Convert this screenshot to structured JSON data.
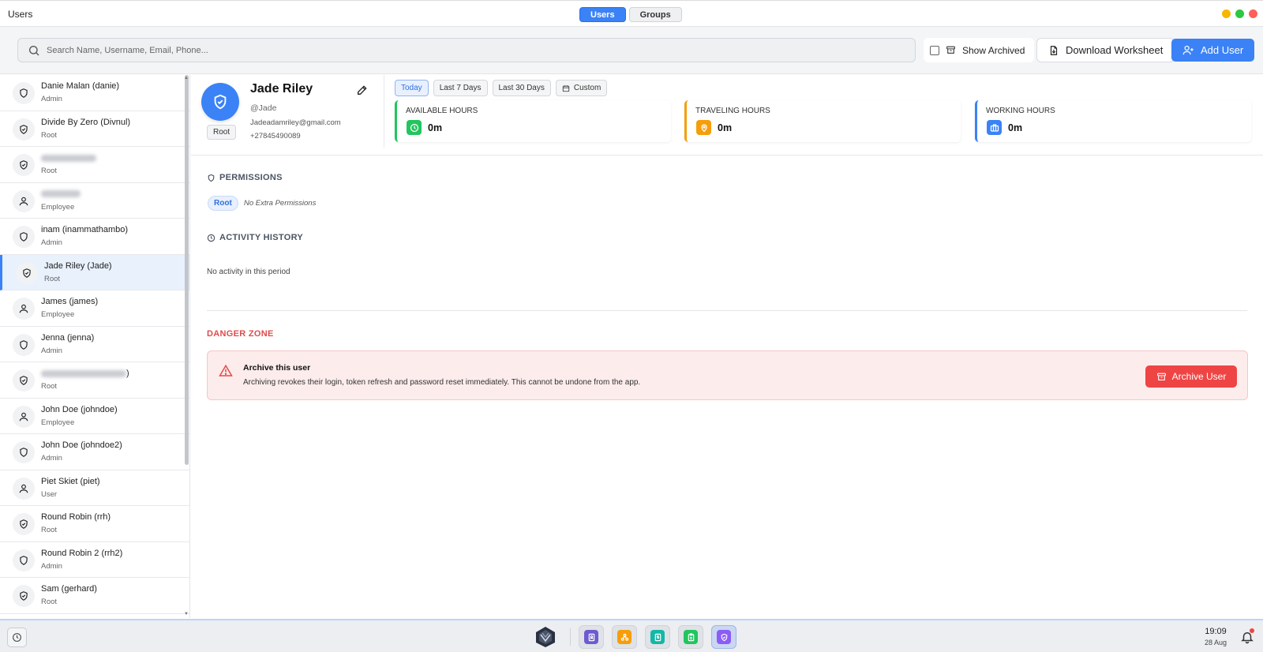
{
  "window": {
    "title": "Users"
  },
  "view_tabs": [
    {
      "label": "Users",
      "active": true
    },
    {
      "label": "Groups",
      "active": false
    }
  ],
  "window_controls": {
    "minimize_color": "#f5b700",
    "maximize_color": "#2bc840",
    "close_color": "#ff5f57"
  },
  "search": {
    "placeholder": "Search Name, Username, Email, Phone...",
    "value": ""
  },
  "toolbar": {
    "show_archived_label": "Show Archived",
    "show_archived_checked": false,
    "download_label": "Download Worksheet",
    "add_label": "Add User"
  },
  "users": [
    {
      "name": "Danie Malan (danie)",
      "role": "Admin",
      "icon": "shield-icon"
    },
    {
      "name": "Divide By Zero (Divnul)",
      "role": "Root",
      "icon": "shield-check-icon"
    },
    {
      "name": "",
      "role": "Root",
      "icon": "shield-check-icon",
      "redacted": true
    },
    {
      "name": "",
      "role": "Employee",
      "icon": "person-icon",
      "redacted": true
    },
    {
      "name": "inam (inammathambo)",
      "role": "Admin",
      "icon": "shield-icon"
    },
    {
      "name": "Jade Riley (Jade)",
      "role": "Root",
      "icon": "shield-check-icon",
      "selected": true
    },
    {
      "name": "James (james)",
      "role": "Employee",
      "icon": "person-icon"
    },
    {
      "name": "Jenna (jenna)",
      "role": "Admin",
      "icon": "shield-icon"
    },
    {
      "name": ")",
      "role": "Root",
      "icon": "shield-check-icon",
      "redacted": true
    },
    {
      "name": "John Doe (johndoe)",
      "role": "Employee",
      "icon": "person-icon"
    },
    {
      "name": "John Doe (johndoe2)",
      "role": "Admin",
      "icon": "shield-icon"
    },
    {
      "name": "Piet Skiet (piet)",
      "role": "User",
      "icon": "person-icon"
    },
    {
      "name": "Round Robin (rrh)",
      "role": "Root",
      "icon": "shield-check-icon"
    },
    {
      "name": "Round Robin 2 (rrh2)",
      "role": "Admin",
      "icon": "shield-icon"
    },
    {
      "name": "Sam (gerhard)",
      "role": "Root",
      "icon": "shield-check-icon"
    }
  ],
  "profile": {
    "name": "Jade Riley",
    "username": "@Jade",
    "email": "Jadeadamriley@gmail.com",
    "phone": "+27845490089",
    "role": "Root"
  },
  "ranges": [
    {
      "label": "Today",
      "active": true
    },
    {
      "label": "Last 7 Days",
      "active": false
    },
    {
      "label": "Last 30 Days",
      "active": false
    },
    {
      "label": "Custom",
      "active": false,
      "icon": "calendar-icon"
    }
  ],
  "stats": [
    {
      "title": "AVAILABLE HOURS",
      "value": "0m",
      "color": "#22c55e",
      "icon": "clock-icon"
    },
    {
      "title": "TRAVELING HOURS",
      "value": "0m",
      "color": "#f59e0b",
      "icon": "map-pin-icon"
    },
    {
      "title": "WORKING HOURS",
      "value": "0m",
      "color": "#3b82f6",
      "icon": "briefcase-icon"
    }
  ],
  "permissions": {
    "title": "PERMISSIONS",
    "role_chip": "Root",
    "extra_text": "No Extra Permissions"
  },
  "activity": {
    "title": "ACTIVITY HISTORY",
    "empty_text": "No activity in this period"
  },
  "danger": {
    "title": "DANGER ZONE",
    "heading": "Archive this user",
    "description": "Archiving revokes their login, token refresh and password reset immediately. This cannot be undone from the app.",
    "button_label": "Archive User"
  },
  "taskbar": {
    "time": "19:09",
    "date": "28 Aug",
    "apps": [
      {
        "name": "contacts-app",
        "color": "#6d5bd0",
        "active": false
      },
      {
        "name": "structure-app",
        "color": "#f59e0b",
        "active": false
      },
      {
        "name": "dollar-app",
        "color": "#14b8a6",
        "active": false
      },
      {
        "name": "clipboard-app",
        "color": "#22c55e",
        "active": false
      },
      {
        "name": "shield-app",
        "color": "#8b5cf6",
        "active": true
      }
    ]
  }
}
